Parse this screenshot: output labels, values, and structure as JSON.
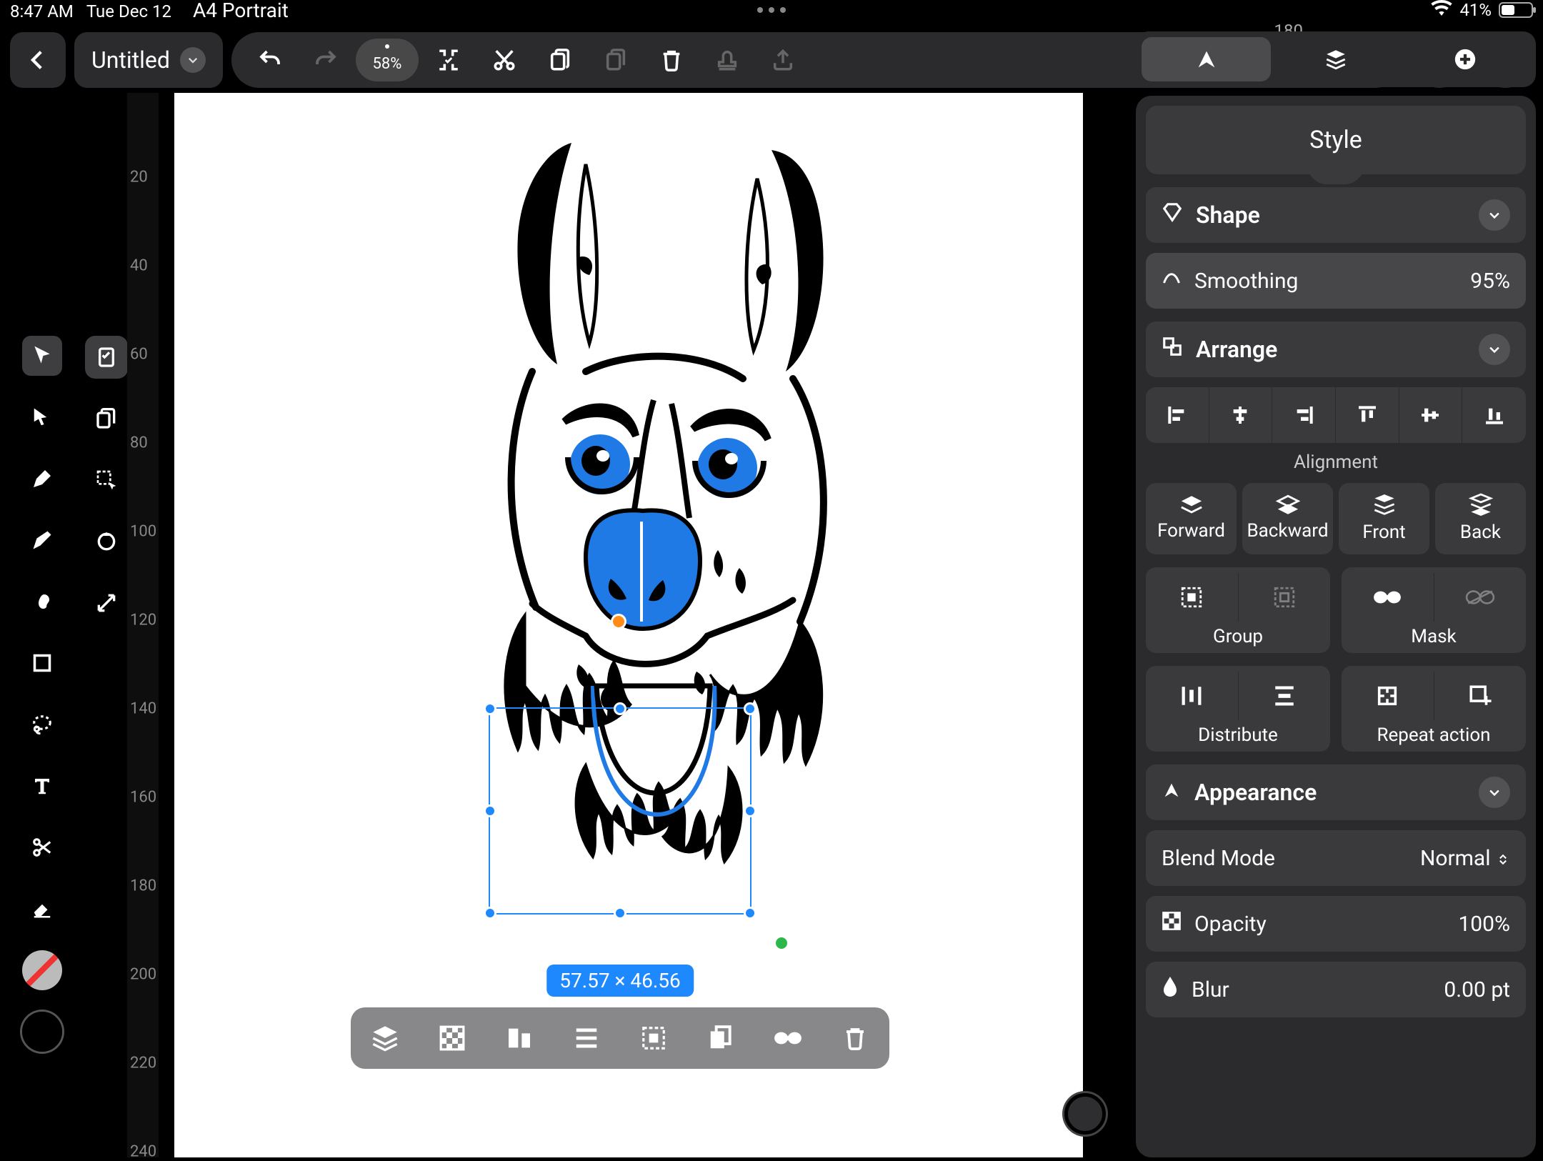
{
  "status": {
    "time": "8:47 AM",
    "date": "Tue Dec 12",
    "page_format": "A4 Portrait",
    "battery_pct": "41%"
  },
  "header": {
    "doc_title": "Untitled",
    "zoom": "58%",
    "ruler_top": "180"
  },
  "ruler": {
    "ticks": [
      "20",
      "40",
      "60",
      "80",
      "100",
      "120",
      "140",
      "160",
      "180",
      "200",
      "220",
      "240"
    ]
  },
  "canvas": {
    "selection_dims": "57.57 × 46.56"
  },
  "inspector": {
    "tab_label": "Style",
    "shape": {
      "title": "Shape",
      "smoothing_label": "Smoothing",
      "smoothing_value": "95%"
    },
    "arrange": {
      "title": "Arrange",
      "alignment_label": "Alignment",
      "stack": {
        "forward": "Forward",
        "backward": "Backward",
        "front": "Front",
        "back": "Back"
      },
      "group_label": "Group",
      "mask_label": "Mask",
      "distribute_label": "Distribute",
      "repeat_label": "Repeat action"
    },
    "appearance": {
      "title": "Appearance",
      "blend_label": "Blend Mode",
      "blend_value": "Normal",
      "opacity_label": "Opacity",
      "opacity_value": "100%",
      "blur_label": "Blur",
      "blur_value": "0.00 pt"
    }
  }
}
